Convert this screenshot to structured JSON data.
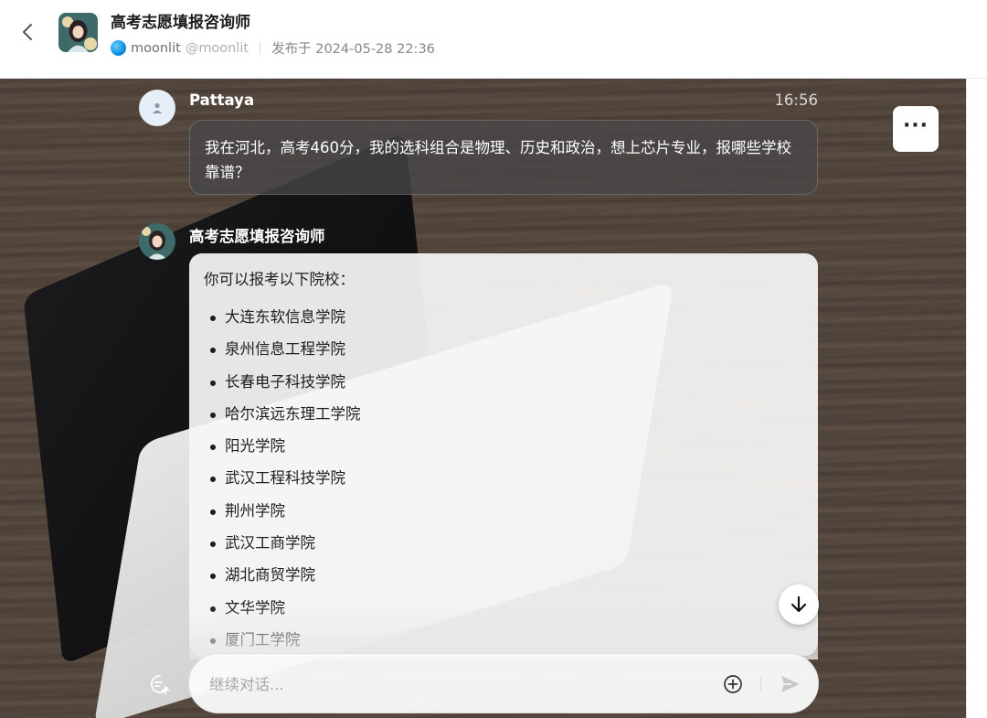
{
  "header": {
    "title": "高考志愿填报咨询师",
    "author_name": "moonlit",
    "author_handle": "@moonlit",
    "published": "发布于 2024-05-28 22:36"
  },
  "messages": {
    "user": {
      "name": "Pattaya",
      "time": "16:56",
      "text": "我在河北，高考460分，我的选科组合是物理、历史和政治，想上芯片专业，报哪些学校靠谱？"
    },
    "bot": {
      "name": "高考志愿填报咨询师",
      "intro": "你可以报考以下院校：",
      "schools": [
        "大连东软信息学院",
        "泉州信息工程学院",
        "长春电子科技学院",
        "哈尔滨远东理工学院",
        "阳光学院",
        "武汉工程科技学院",
        "荆州学院",
        "武汉工商学院",
        "湖北商贸学院",
        "文华学院",
        "厦门工学院"
      ]
    }
  },
  "input": {
    "placeholder": "继续对话..."
  },
  "icons": {
    "back": "chevron-left-icon",
    "more": "more-dots-icon",
    "scroll_down": "arrow-down-icon",
    "new_chat": "new-chat-icon",
    "attach": "plus-circle-icon",
    "send": "send-icon"
  }
}
